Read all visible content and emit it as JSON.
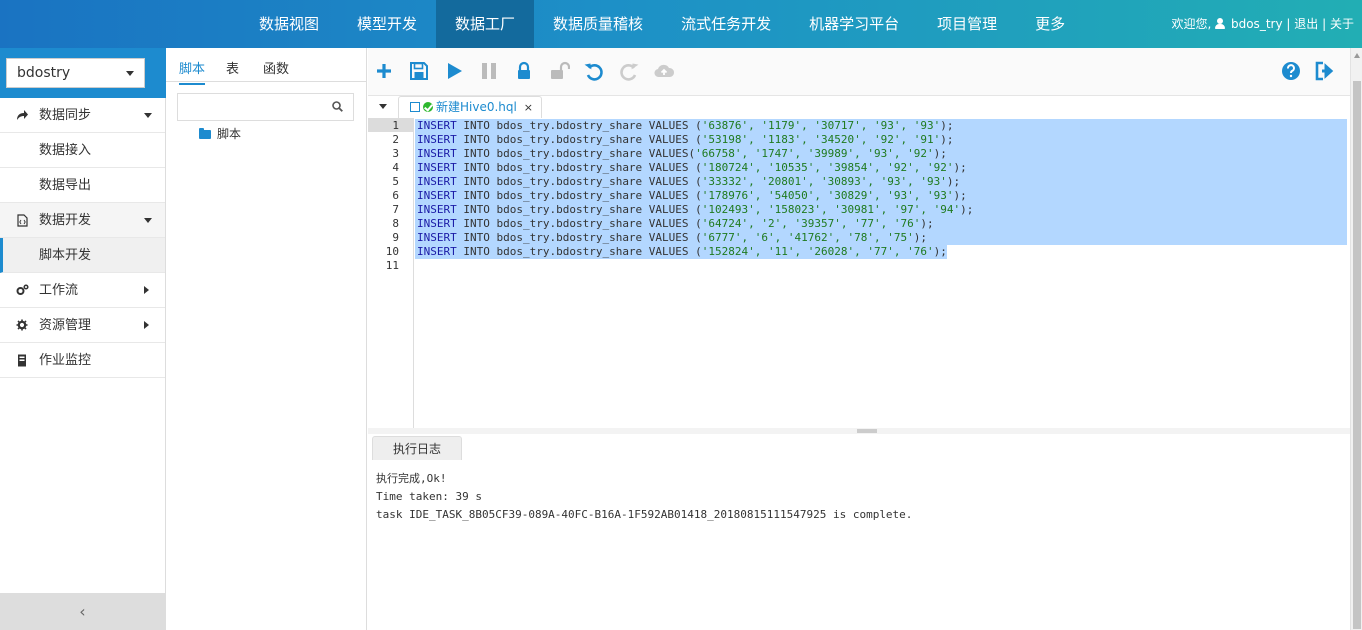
{
  "topbar": {
    "nav": [
      "数据视图",
      "模型开发",
      "数据工厂",
      "数据质量稽核",
      "流式任务开发",
      "机器学习平台",
      "项目管理",
      "更多"
    ],
    "active_nav": "数据工厂",
    "welcome": "欢迎您,",
    "username": "bdos_try",
    "sep1": "|",
    "logout": "退出",
    "sep2": "|",
    "about": "关于"
  },
  "sidebar": {
    "project": "bdostry",
    "groups": [
      {
        "label": "数据同步",
        "icon": "share-icon"
      },
      {
        "label": "数据开发",
        "icon": "file-code-icon"
      },
      {
        "label": "工作流",
        "icon": "cogs-icon"
      },
      {
        "label": "资源管理",
        "icon": "cog-icon"
      },
      {
        "label": "作业监控",
        "icon": "server-icon"
      }
    ],
    "sub_sync": [
      "数据接入",
      "数据导出"
    ],
    "sub_dev": [
      "脚本开发"
    ],
    "collapse": "‹"
  },
  "panel2": {
    "tabs": [
      "脚本",
      "表",
      "函数"
    ],
    "search_placeholder": "",
    "tree_root": "脚本"
  },
  "toolbar": {
    "buttons": [
      "add-icon",
      "save-icon",
      "run-icon",
      "pause-icon",
      "lock-icon",
      "unlock-icon",
      "undo-icon",
      "redo-icon",
      "upload-icon",
      "help-icon",
      "exit-icon"
    ]
  },
  "editor": {
    "file_tab": "新建Hive0.hql",
    "close": "×",
    "lines": [
      {
        "n": "1",
        "kw": "INSERT",
        "mid": " INTO bdos_try.bdostry_share VALUES (",
        "vals": "'63876', '1179', '30717', '93', '93'",
        "end": ");"
      },
      {
        "n": "2",
        "kw": "INSERT",
        "mid": " INTO bdos_try.bdostry_share VALUES (",
        "vals": "'53198', '1183', '34520', '92', '91'",
        "end": ");"
      },
      {
        "n": "3",
        "kw": "INSERT",
        "mid": " INTO bdos_try.bdostry_share VALUES(",
        "vals": "'66758', '1747', '39989', '93', '92'",
        "end": ");"
      },
      {
        "n": "4",
        "kw": "INSERT",
        "mid": " INTO bdos_try.bdostry_share VALUES (",
        "vals": "'180724', '10535', '39854', '92', '92'",
        "end": ");"
      },
      {
        "n": "5",
        "kw": "INSERT",
        "mid": " INTO bdos_try.bdostry_share VALUES (",
        "vals": "'33332', '20801', '30893', '93', '93'",
        "end": ");"
      },
      {
        "n": "6",
        "kw": "INSERT",
        "mid": " INTO bdos_try.bdostry_share VALUES (",
        "vals": "'178976', '54050', '30829', '93', '93'",
        "end": ");"
      },
      {
        "n": "7",
        "kw": "INSERT",
        "mid": " INTO bdos_try.bdostry_share VALUES (",
        "vals": "'102493', '158023', '30981', '97', '94'",
        "end": ");"
      },
      {
        "n": "8",
        "kw": "INSERT",
        "mid": " INTO bdos_try.bdostry_share VALUES (",
        "vals": "'64724', '2', '39357', '77', '76'",
        "end": ");"
      },
      {
        "n": "9",
        "kw": "INSERT",
        "mid": " INTO bdos_try.bdostry_share VALUES (",
        "vals": "'6777', '6', '41762', '78', '75'",
        "end": ");"
      },
      {
        "n": "10",
        "kw": "INSERT",
        "mid": " INTO bdos_try.bdostry_share VALUES (",
        "vals": "'152824', '11', '26028', '77', '76'",
        "end": ");"
      },
      {
        "n": "11",
        "kw": "",
        "mid": "",
        "vals": "",
        "end": ""
      }
    ]
  },
  "log": {
    "tab": "执行日志",
    "line1": "执行完成,Ok!",
    "line2": "",
    "line3": "Time taken: 39 s",
    "line4": "task IDE_TASK_8B05CF39-089A-40FC-B16A-1F592AB01418_20180815111547925 is complete."
  },
  "colors": {
    "accent": "#1d8bcf",
    "topbar_start": "#1a73c2",
    "topbar_end": "#22aeb4",
    "selection": "#b3d7ff"
  }
}
